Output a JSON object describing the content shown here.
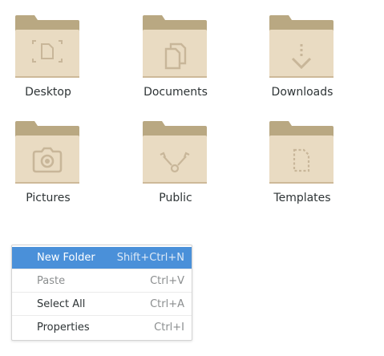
{
  "colors": {
    "folder_back": "#b9a882",
    "folder_front": "#e9dbc2",
    "folder_shadow": "#cdb999",
    "folder_glyph": "#c8b699",
    "menu_highlight": "#4a90d9"
  },
  "folders": [
    {
      "label": "Desktop",
      "icon": "desktop-icon"
    },
    {
      "label": "Documents",
      "icon": "documents-icon"
    },
    {
      "label": "Downloads",
      "icon": "downloads-icon"
    },
    {
      "label": "Pictures",
      "icon": "pictures-icon"
    },
    {
      "label": "Public",
      "icon": "public-icon"
    },
    {
      "label": "Templates",
      "icon": "templates-icon"
    }
  ],
  "context_menu": {
    "items": [
      {
        "label": "New Folder",
        "shortcut": "Shift+Ctrl+N",
        "state": "highlighted"
      },
      {
        "label": "Paste",
        "shortcut": "Ctrl+V",
        "state": "disabled"
      },
      {
        "label": "Select All",
        "shortcut": "Ctrl+A",
        "state": "normal"
      },
      {
        "label": "Properties",
        "shortcut": "Ctrl+I",
        "state": "normal"
      }
    ]
  }
}
